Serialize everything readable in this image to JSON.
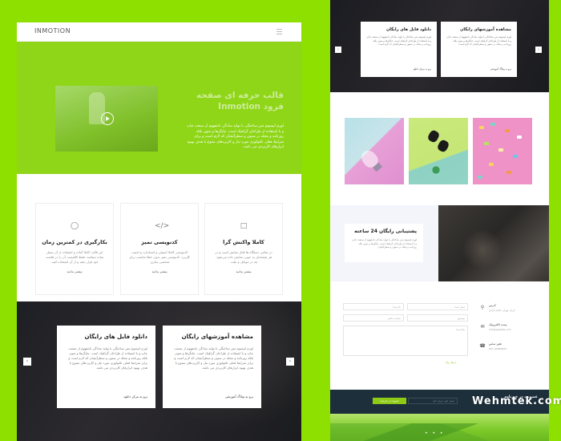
{
  "left": {
    "logo": "INMOTION",
    "hero": {
      "title": "قالب حرفه ای صفحه فرود Inmotion",
      "text": "لورم ایپسوم متن ساختگی با تولید سادگی نامفهوم از صنعت چاپ و با استفاده از طراحان گرافیک است. چاپگرها و متون بلکه روزنامه و مجله در ستون و سطرآنچنان که لازم است و برای شرایط فعلی تکنولوژی مورد نیاز و کاربردهای متنوع با هدف بهبود ابزارهای کاربردی می باشد."
    },
    "features": [
      {
        "icon": "clock-icon",
        "title": "بکارگیری در کمترین زمان",
        "text": "این قالب کاملا آماده و استفاده از آن بسیار ساده میباشد. فقط کافیست آن را در هاست خود قرار دهید و از آن استفاده کنید.",
        "more": "بیشتر بدانید"
      },
      {
        "icon": "code-icon",
        "title": "کدنویسی تمیز",
        "text": "کدنویسی کاملا اصولی و استاندارد و امنیت کاربرد. کدنویسی تمیز بدون خطا مناسب برای شخصی سازی.",
        "more": "بیشتر بدانید"
      },
      {
        "icon": "monitor-icon",
        "title": "کاملا واکنش گرا",
        "text": "در تمامی دستگاه ها قابل نمایش است و در هر صفحه‌ای به خوبی نمایش داده می‌شود. چه در موبایل و تبلت.",
        "more": "بیشتر بدانید"
      }
    ],
    "cards": [
      {
        "title": "دانلود فایل های رایگان",
        "text": "لورم ایپسوم متن ساختگی با تولید سادگی نامفهوم از صنعت چاپ و با استفاده از طراحان گرافیک است. چاپگرها و متون بلکه روزنامه و مجله در ستون و سطرآنچنان که لازم است و برای شرایط فعلی تکنولوژی مورد نیاز و کاربردهای متنوع با هدف بهبود ابزارهای کاربردی می باشد.",
        "link": "برو به مرکز دانلود"
      },
      {
        "title": "مشاهده آموزشهای رایگان",
        "text": "لورم ایپسوم متن ساختگی با تولید سادگی نامفهوم از صنعت چاپ و با استفاده از طراحان گرافیک است. چاپگرها و متون بلکه روزنامه و مجله در ستون و سطرآنچنان که لازم است و برای شرایط فعلی تکنولوژی مورد نیاز و کاربردهای متنوع با هدف بهبود ابزارهای کاربردی می باشد.",
        "link": "برو به وبلاگ آموزشی"
      }
    ]
  },
  "right": {
    "cards": [
      {
        "title": "دانلود فایل های رایگان",
        "text": "لورم ایپسوم متن ساختگی با تولید سادگی نامفهوم از صنعت چاپ و با استفاده از طراحان گرافیک است. چاپگرها و متون بلکه روزنامه و مجله در ستون و سطرآنچنان که لازم است.",
        "link": "برو به مرکز دانلود"
      },
      {
        "title": "مشاهده آموزشهای رایگان",
        "text": "لورم ایپسوم متن ساختگی با تولید سادگی نامفهوم از صنعت چاپ و با استفاده از طراحان گرافیک است. چاپگرها و متون بلکه روزنامه و مجله در ستون و سطرآنچنان که لازم است.",
        "link": "برو به وبلاگ آموزشی"
      }
    ],
    "support": {
      "title": "پشتیبانی رایگان 24 ساعته",
      "text": "لورم ایپسوم متن ساختگی با تولید سادگی نامفهوم از صنعت چاپ و با استفاده از طراحان گرافیک است. چاپگرها و متون بلکه روزنامه و مجله در ستون و سطرآنچنان."
    },
    "form": {
      "name": "نام شما",
      "email": "ایمیل شما",
      "phone": "شماره تماس",
      "subject": "موضوع",
      "message": "پیام شما",
      "send": "ارسال پیام"
    },
    "info": [
      {
        "icon": "pin-icon",
        "label": "آدرس",
        "value": "ایران، تهران، خیابان آزادی"
      },
      {
        "icon": "mail-icon",
        "label": "پست الکترونیک",
        "value": "info@website.com"
      },
      {
        "icon": "phone-icon",
        "label": "تلفن تماس",
        "value": "021-00000000"
      }
    ],
    "newsletter": {
      "title": "عضویت در خبرنامه",
      "placeholder": "ایمیل خود را وارد کنید",
      "button": "عضویت در خبرنامه"
    }
  },
  "watermark": "Wehmtek.com"
}
